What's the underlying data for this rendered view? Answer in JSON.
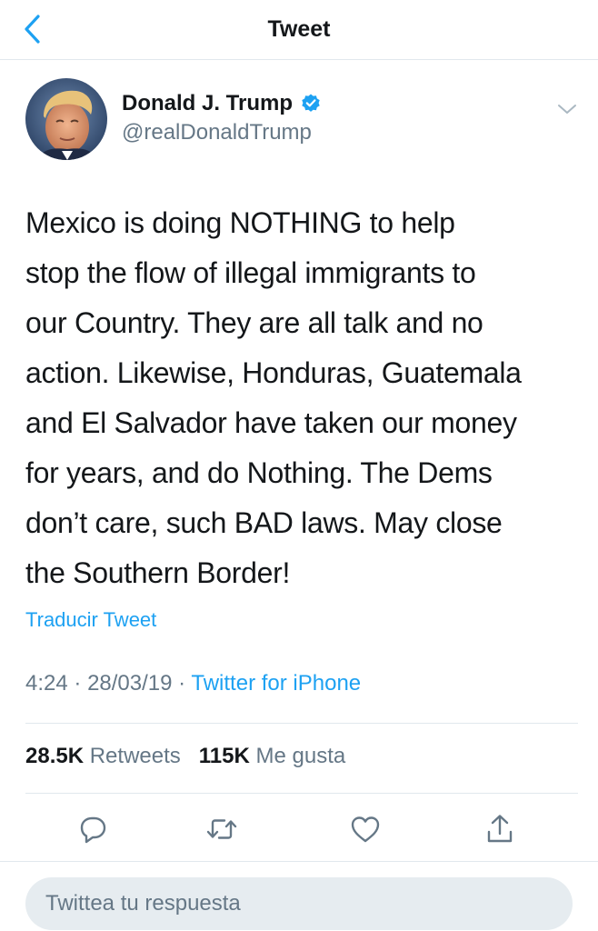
{
  "header": {
    "title": "Tweet",
    "back_icon": "chevron-left-icon"
  },
  "author": {
    "name": "Donald J. Trump",
    "handle": "@realDonaldTrump",
    "verified": true,
    "verified_icon": "verified-badge-icon",
    "menu_icon": "chevron-down-icon"
  },
  "tweet": {
    "lines": [
      "Mexico is doing NOTHING to help",
      "stop the flow of illegal immigrants to",
      "our Country. They are all talk and no",
      "action. Likewise, Honduras, Guatemala",
      "and El Salvador have taken our money",
      "for years, and do Nothing. The Dems",
      "don’t care, such BAD laws. May close",
      "the Southern Border!"
    ],
    "translate_label": "Traducir Tweet",
    "time": "4:24",
    "date": "28/03/19",
    "separator": "·",
    "source": "Twitter for iPhone"
  },
  "stats": {
    "retweets_count": "28.5K",
    "retweets_label": "Retweets",
    "likes_count": "115K",
    "likes_label": "Me gusta"
  },
  "actions": [
    {
      "name": "reply",
      "icon": "reply-icon"
    },
    {
      "name": "retweet",
      "icon": "retweet-icon"
    },
    {
      "name": "like",
      "icon": "heart-icon"
    },
    {
      "name": "share",
      "icon": "share-icon"
    }
  ],
  "reply": {
    "placeholder": "Twittea tu respuesta",
    "value": ""
  },
  "colors": {
    "accent": "#1da1f2",
    "text_primary": "#14171a",
    "text_secondary": "#657786",
    "divider": "#e1e8ed",
    "input_bg": "#e6ecf0"
  }
}
